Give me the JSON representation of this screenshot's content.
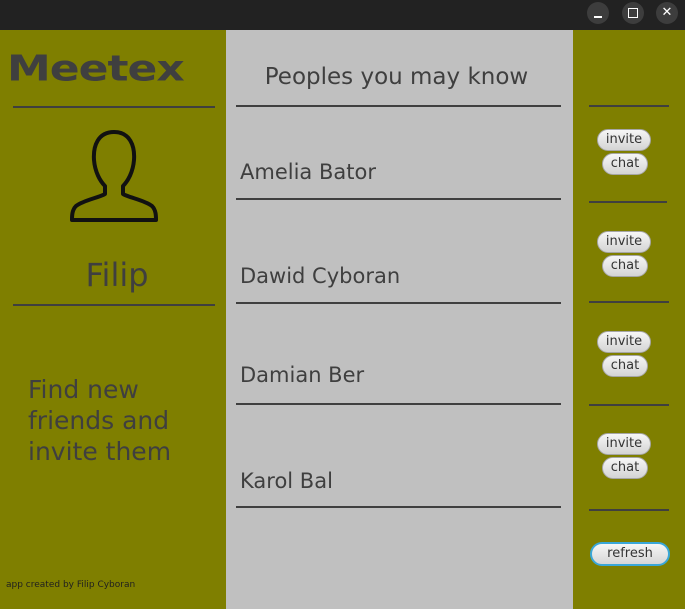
{
  "window": {
    "minimize_label": "",
    "maximize_label": "",
    "close_label": "✕"
  },
  "sidebar": {
    "logo": "Meetex",
    "username": "Filip",
    "tagline": "Find new friends and invite them",
    "credit": "app created by Filip Cyboran"
  },
  "main": {
    "title": "Peoples you may know",
    "people": [
      {
        "name": "Amelia Bator"
      },
      {
        "name": "Dawid Cyboran"
      },
      {
        "name": "Damian Ber"
      },
      {
        "name": "Karol Bal"
      }
    ]
  },
  "actions": {
    "invite_label": "invite",
    "chat_label": "chat",
    "refresh_label": "refresh"
  },
  "colors": {
    "panel_olive": "#7f7f00",
    "panel_gray": "#c0c0c0",
    "text_dark": "#3f3f3f",
    "focus_blue": "#3aa7d8"
  }
}
